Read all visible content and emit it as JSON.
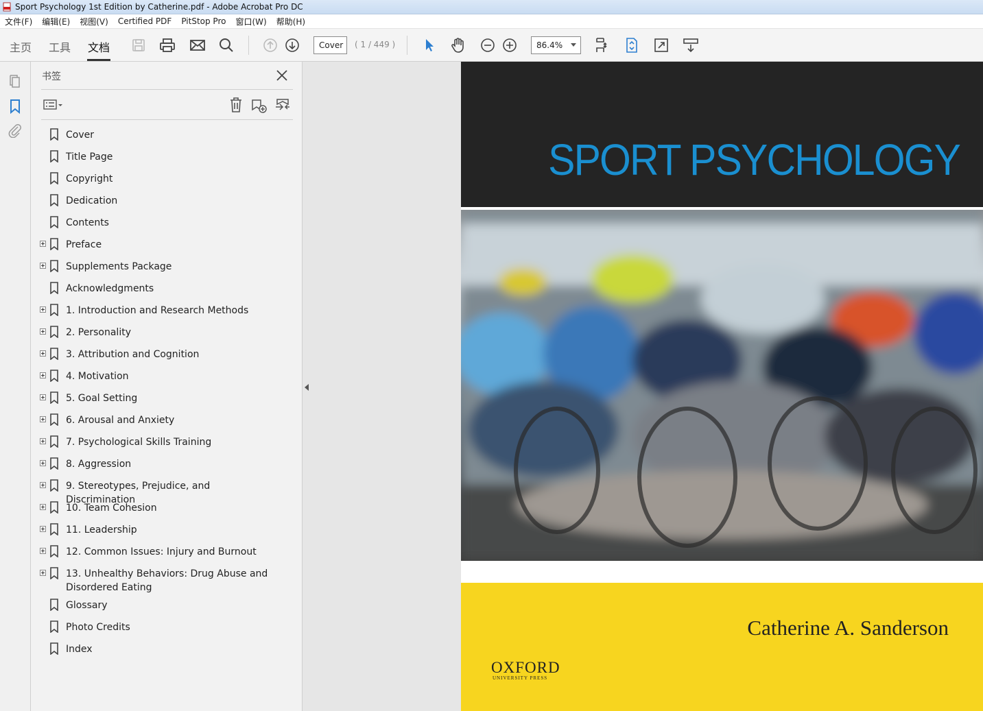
{
  "window": {
    "title": "Sport Psychology 1st Edition by Catherine.pdf - Adobe Acrobat Pro DC"
  },
  "menubar": [
    "文件(F)",
    "编辑(E)",
    "视图(V)",
    "Certified PDF",
    "PitStop Pro",
    "窗口(W)",
    "帮助(H)"
  ],
  "toolbar": {
    "tabs": {
      "home": "主页",
      "tools": "工具",
      "document": "文档"
    },
    "active_tab": "文档",
    "page_field": "Cover",
    "page_count": "( 1 / 449 )",
    "zoom": "86.4%",
    "accent": "#2d7fd0"
  },
  "panel": {
    "title": "书签",
    "bookmarks": [
      {
        "label": "Cover",
        "expandable": false
      },
      {
        "label": "Title Page",
        "expandable": false
      },
      {
        "label": "Copyright",
        "expandable": false
      },
      {
        "label": "Dedication",
        "expandable": false
      },
      {
        "label": "Contents",
        "expandable": false
      },
      {
        "label": "Preface",
        "expandable": true
      },
      {
        "label": "Supplements Package",
        "expandable": true
      },
      {
        "label": "Acknowledgments",
        "expandable": false
      },
      {
        "label": "1. Introduction and Research Methods",
        "expandable": true
      },
      {
        "label": "2. Personality",
        "expandable": true
      },
      {
        "label": "3. Attribution and Cognition",
        "expandable": true
      },
      {
        "label": "4. Motivation",
        "expandable": true
      },
      {
        "label": "5. Goal Setting",
        "expandable": true
      },
      {
        "label": "6. Arousal and Anxiety",
        "expandable": true
      },
      {
        "label": "7. Psychological Skills Training",
        "expandable": true
      },
      {
        "label": "8. Aggression",
        "expandable": true
      },
      {
        "label": "9. Stereotypes, Prejudice, and Discrimination",
        "expandable": true
      },
      {
        "label": "10. Team Cohesion",
        "expandable": true
      },
      {
        "label": "11. Leadership",
        "expandable": true
      },
      {
        "label": "12. Common Issues: Injury and Burnout",
        "expandable": true
      },
      {
        "label": "13. Unhealthy Behaviors: Drug Abuse and Disordered Eating",
        "expandable": true
      },
      {
        "label": "Glossary",
        "expandable": false
      },
      {
        "label": "Photo Credits",
        "expandable": false
      },
      {
        "label": "Index",
        "expandable": false
      }
    ]
  },
  "document": {
    "cover_title": "SPORT PSYCHOLOGY",
    "author": "Catherine A. Sanderson",
    "publisher": "OXFORD",
    "publisher_sub": "UNIVERSITY PRESS",
    "title_color": "#1a8fd0",
    "band_color": "#f7d51f"
  }
}
